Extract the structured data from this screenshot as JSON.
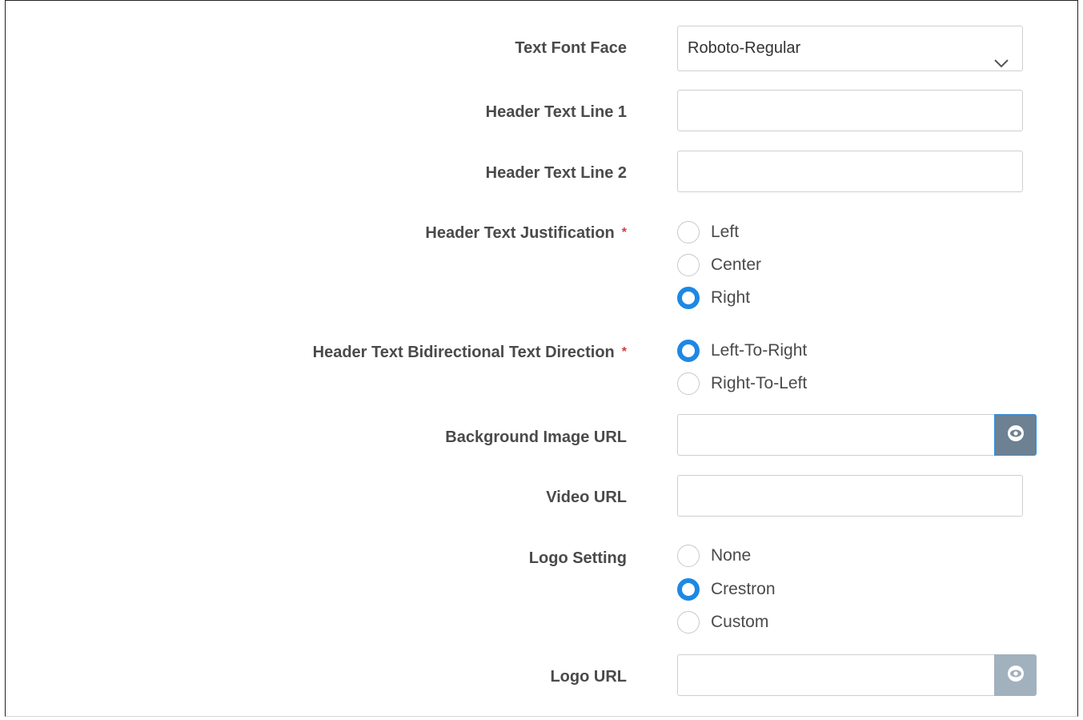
{
  "form": {
    "font_face": {
      "label": "Text Font Face",
      "value": "Roboto-Regular"
    },
    "header_line1": {
      "label": "Header Text Line 1",
      "value": ""
    },
    "header_line2": {
      "label": "Header Text Line 2",
      "value": ""
    },
    "justification": {
      "label": "Header Text Justification",
      "required_mark": "*",
      "options": [
        "Left",
        "Center",
        "Right"
      ],
      "selected": "Right"
    },
    "direction": {
      "label": "Header Text Bidirectional Text Direction",
      "required_mark": "*",
      "options": [
        "Left-To-Right",
        "Right-To-Left"
      ],
      "selected": "Left-To-Right"
    },
    "background_url": {
      "label": "Background Image URL",
      "value": "",
      "preview_icon": "eye-icon"
    },
    "video_url": {
      "label": "Video URL",
      "value": ""
    },
    "logo_setting": {
      "label": "Logo Setting",
      "options": [
        "None",
        "Crestron",
        "Custom"
      ],
      "selected": "Crestron"
    },
    "logo_url": {
      "label": "Logo URL",
      "value": "",
      "preview_icon": "eye-icon"
    }
  },
  "colors": {
    "accent": "#1e88e5",
    "required": "#d9363e",
    "preview_button": "#6d8192",
    "preview_button_disabled": "#a2b1be"
  }
}
